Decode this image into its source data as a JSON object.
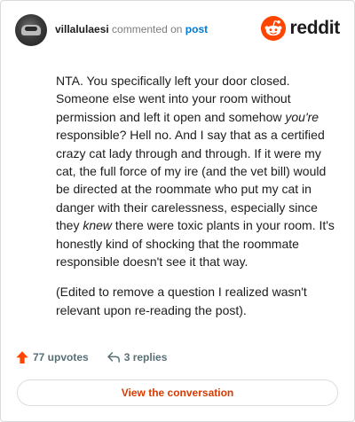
{
  "comment": {
    "username": "villalulaesi",
    "action_text": "commented on",
    "post_link": "post",
    "paragraphs": [
      {
        "p1": "NTA. You specifically left your door closed. Someone else went into your room without permission and left it open and somehow ",
        "em1": "you're",
        "p2": " responsible? Hell no. And I say that as a certified crazy cat lady through and through. If it were my cat, the full force of my ire (and the vet bill) would be directed at the roommate who put my cat in danger with their carelessness, especially since they ",
        "em2": "knew",
        "p3": " there were toxic plants in your room. It's honestly kind of shocking that the roommate responsible doesn't see it that way."
      },
      "(Edited to remove a question I realized wasn't relevant upon re-reading the post)."
    ]
  },
  "brand": {
    "wordmark": "reddit",
    "color": "#ff4500"
  },
  "footer": {
    "upvotes": "77 upvotes",
    "replies": "3 replies",
    "view_conversation": "View the conversation"
  },
  "icons": {
    "upvote": "upvote-arrow-icon",
    "reply": "reply-icon",
    "logo": "reddit-snoo-icon",
    "avatar": "user-avatar"
  }
}
